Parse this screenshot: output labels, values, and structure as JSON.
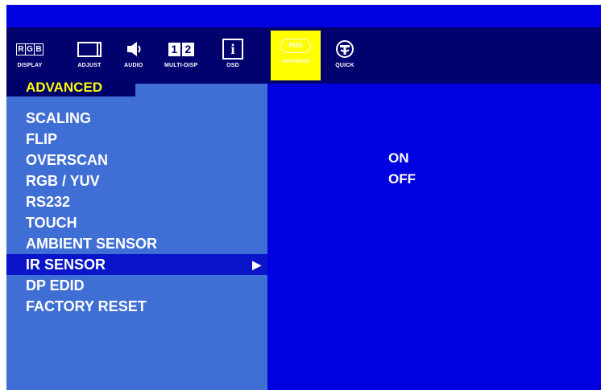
{
  "tabs": [
    {
      "label": "DISPLAY",
      "icon": "rgb-display-icon",
      "glyph": [
        "R",
        "G",
        "B"
      ]
    },
    {
      "label": "ADJUST",
      "icon": "adjust-icon"
    },
    {
      "label": "AUDIO",
      "icon": "speaker-icon"
    },
    {
      "label": "MULTI-DISP",
      "icon": "multi-display-icon",
      "glyph": [
        "1",
        "2"
      ]
    },
    {
      "label": "OSD",
      "icon": "info-icon",
      "glyph": "i"
    },
    {
      "label": "ADVANCED",
      "icon": "pro-icon",
      "glyph": "PRO",
      "selected": true
    },
    {
      "label": "QUICK",
      "icon": "quick-icon"
    }
  ],
  "section_title": "ADVANCED",
  "menu": [
    {
      "label": "SCALING"
    },
    {
      "label": "FLIP"
    },
    {
      "label": "OVERSCAN"
    },
    {
      "label": "RGB / YUV"
    },
    {
      "label": "RS232"
    },
    {
      "label": "TOUCH"
    },
    {
      "label": "AMBIENT SENSOR"
    },
    {
      "label": "IR SENSOR",
      "highlighted": true,
      "arrow": "▶"
    },
    {
      "label": "DP EDID"
    },
    {
      "label": "FACTORY RESET"
    }
  ],
  "options": [
    "ON",
    "OFF"
  ],
  "colors": {
    "background": "#0000e0",
    "iconbar": "#02026e",
    "sidepanel": "#3f6fd4",
    "highlight": "#0a14c8",
    "selected_tab": "#ffff00",
    "title_text": "#ffff00"
  }
}
